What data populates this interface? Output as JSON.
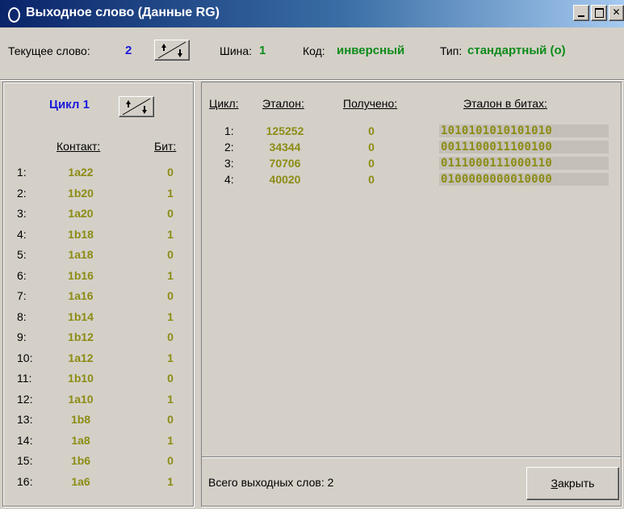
{
  "window": {
    "title": "Выходное слово (Данные RG)"
  },
  "header": {
    "current_word_label": "Текущее слово:",
    "current_word_value": "2",
    "bus_label": "Шина:",
    "bus_value": "1",
    "code_label": "Код:",
    "code_value": "инверсный",
    "type_label": "Тип:",
    "type_value": "стандартный (о)"
  },
  "left_panel": {
    "cycle_label": "Цикл 1",
    "col_contact": "Контакт:",
    "col_bit": "Бит:",
    "rows": [
      {
        "idx": "1:",
        "contact": "1a22",
        "bit": "0"
      },
      {
        "idx": "2:",
        "contact": "1b20",
        "bit": "1"
      },
      {
        "idx": "3:",
        "contact": "1a20",
        "bit": "0"
      },
      {
        "idx": "4:",
        "contact": "1b18",
        "bit": "1"
      },
      {
        "idx": "5:",
        "contact": "1a18",
        "bit": "0"
      },
      {
        "idx": "6:",
        "contact": "1b16",
        "bit": "1"
      },
      {
        "idx": "7:",
        "contact": "1a16",
        "bit": "0"
      },
      {
        "idx": "8:",
        "contact": "1b14",
        "bit": "1"
      },
      {
        "idx": "9:",
        "contact": "1b12",
        "bit": "0"
      },
      {
        "idx": "10:",
        "contact": "1a12",
        "bit": "1"
      },
      {
        "idx": "11:",
        "contact": "1b10",
        "bit": "0"
      },
      {
        "idx": "12:",
        "contact": "1a10",
        "bit": "1"
      },
      {
        "idx": "13:",
        "contact": "1b8",
        "bit": "0"
      },
      {
        "idx": "14:",
        "contact": "1a8",
        "bit": "1"
      },
      {
        "idx": "15:",
        "contact": "1b6",
        "bit": "0"
      },
      {
        "idx": "16:",
        "contact": "1a6",
        "bit": "1"
      }
    ]
  },
  "right_panel": {
    "col_cycle": "Цикл:",
    "col_reference": "Эталон:",
    "col_received": "Получено:",
    "col_bits": "Эталон в битах:",
    "rows": [
      {
        "cycle": "1:",
        "reference": "125252",
        "received": "0",
        "bits": "1010101010101010"
      },
      {
        "cycle": "2:",
        "reference": "34344",
        "received": "0",
        "bits": "0011100011100100"
      },
      {
        "cycle": "3:",
        "reference": "70706",
        "received": "0",
        "bits": "0111000111000110"
      },
      {
        "cycle": "4:",
        "reference": "40020",
        "received": "0",
        "bits": "0100000000010000"
      }
    ],
    "total_label": "Всего выходных слов: 2"
  },
  "buttons": {
    "close_accel": "З",
    "close_rest": "акрыть"
  },
  "colors": {
    "title_gradient_start": "#0a246a",
    "title_gradient_end": "#a6caf0",
    "value_blue": "#1a1adc",
    "value_green": "#0c8c1a",
    "value_olive": "#8c8c14"
  }
}
